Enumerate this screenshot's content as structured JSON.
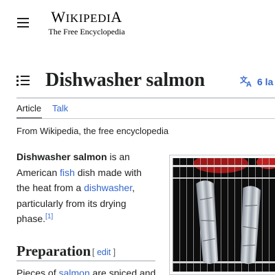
{
  "header": {
    "logo_word_first": "W",
    "logo_word_small": "IKIPEDI",
    "logo_word_last": "A",
    "logo_tagline": "The Free Encyclopedia",
    "menu_icon": "hamburger-menu-icon"
  },
  "page": {
    "title": "Dishwasher salmon",
    "toc_icon": "table-of-contents-icon",
    "languages": {
      "icon": "language-icon",
      "label": "6 la"
    },
    "tabs": [
      {
        "label": "Article",
        "active": true
      },
      {
        "label": "Talk",
        "active": false
      }
    ],
    "tagline": "From Wikipedia, the free encyclopedia"
  },
  "lead": {
    "bold_term": "Dishwasher salmon",
    "text_1": " is an American ",
    "link_fish": "fish",
    "text_2": " dish made with the heat from a ",
    "link_dishwasher": "dishwasher",
    "text_3": ", particularly from its drying phase.",
    "ref": "[1]"
  },
  "section": {
    "title": "Preparation",
    "edit_open": "[ ",
    "edit_label": "edit",
    "edit_close": " ]"
  },
  "para2": {
    "text_1": "Pieces of ",
    "link_salmon": "salmon",
    "text_2": " are spiced and"
  },
  "colors": {
    "link": "#3366cc",
    "text": "#202122",
    "rule": "#a2a9b1"
  }
}
